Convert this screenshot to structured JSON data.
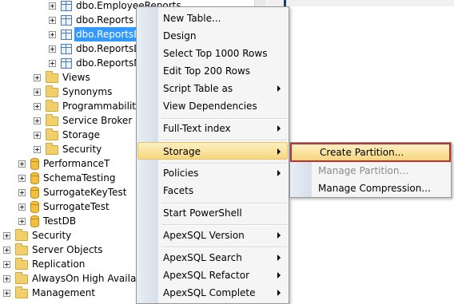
{
  "tree": {
    "items": [
      {
        "label": "dbo.EmployeeReports",
        "icon": "table-icon",
        "selected": false
      },
      {
        "label": "dbo.Reports",
        "icon": "table-icon",
        "selected": false
      },
      {
        "label": "dbo.ReportsD",
        "icon": "table-icon",
        "selected": true
      },
      {
        "label": "dbo.ReportsD",
        "icon": "table-icon",
        "selected": false
      },
      {
        "label": "dbo.ReportsM",
        "icon": "table-icon",
        "selected": false
      },
      {
        "label": "Views",
        "icon": "folder-icon"
      },
      {
        "label": "Synonyms",
        "icon": "folder-icon"
      },
      {
        "label": "Programmability",
        "icon": "folder-icon"
      },
      {
        "label": "Service Broker",
        "icon": "folder-icon"
      },
      {
        "label": "Storage",
        "icon": "folder-icon"
      },
      {
        "label": "Security",
        "icon": "folder-icon"
      },
      {
        "label": "PerformanceT",
        "icon": "database-icon"
      },
      {
        "label": "SchemaTesting",
        "icon": "database-icon"
      },
      {
        "label": "SurrogateKeyTest",
        "icon": "database-icon"
      },
      {
        "label": "SurrogateTest",
        "icon": "database-icon"
      },
      {
        "label": "TestDB",
        "icon": "database-icon"
      },
      {
        "label": "Security",
        "icon": "folder-icon"
      },
      {
        "label": "Server Objects",
        "icon": "folder-icon"
      },
      {
        "label": "Replication",
        "icon": "folder-icon"
      },
      {
        "label": "AlwaysOn High Availabi",
        "icon": "folder-icon"
      },
      {
        "label": "Management",
        "icon": "folder-icon"
      }
    ]
  },
  "context_menu": {
    "items": [
      {
        "label": "New Table..."
      },
      {
        "label": "Design"
      },
      {
        "label": "Select Top 1000 Rows"
      },
      {
        "label": "Edit Top 200 Rows"
      },
      {
        "label": "Script Table as",
        "submenu": true
      },
      {
        "label": "View Dependencies"
      },
      {
        "label": "Full-Text index",
        "submenu": true
      },
      {
        "label": "Storage",
        "submenu": true,
        "active": true
      },
      {
        "label": "Policies",
        "submenu": true
      },
      {
        "label": "Facets"
      },
      {
        "label": "Start PowerShell"
      },
      {
        "label": "ApexSQL Version",
        "submenu": true
      },
      {
        "label": "ApexSQL Search",
        "submenu": true
      },
      {
        "label": "ApexSQL Refactor",
        "submenu": true
      },
      {
        "label": "ApexSQL Complete",
        "submenu": true
      }
    ]
  },
  "storage_submenu": {
    "items": [
      {
        "label": "Create Partition...",
        "state": "highlighted"
      },
      {
        "label": "Manage Partition...",
        "state": "disabled"
      },
      {
        "label": "Manage Compression...",
        "state": "enabled"
      }
    ]
  },
  "colors": {
    "selection": "#3399ff",
    "highlight_border": "#c0302e",
    "menu_hover": "#f7d67e"
  }
}
